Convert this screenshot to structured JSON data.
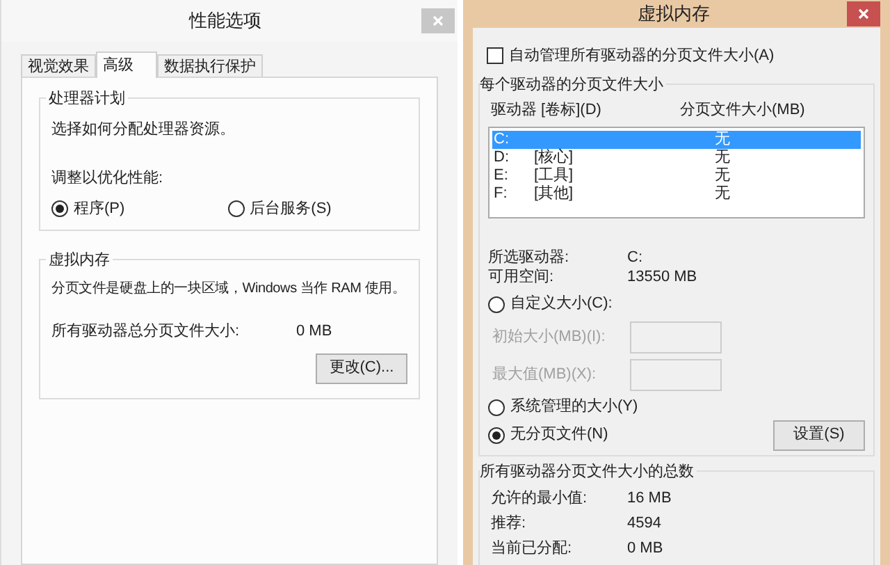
{
  "performance_window": {
    "title": "性能选项",
    "tabs": [
      {
        "label": "视觉效果",
        "selected": false
      },
      {
        "label": "高级",
        "selected": true
      },
      {
        "label": "数据执行保护",
        "selected": false
      }
    ],
    "processor_group": {
      "title": "处理器计划",
      "description": "选择如何分配处理器资源。",
      "adjust_label": "调整以优化性能:",
      "options": [
        {
          "label": "程序(P)",
          "selected": true
        },
        {
          "label": "后台服务(S)",
          "selected": false
        }
      ]
    },
    "virtual_memory_group": {
      "title": "虚拟内存",
      "description": "分页文件是硬盘上的一块区域，Windows 当作 RAM 使用。",
      "total_label": "所有驱动器总分页文件大小:",
      "total_value": "0 MB",
      "change_button": "更改(C)..."
    }
  },
  "virtual_memory_window": {
    "title": "虚拟内存",
    "auto_manage": {
      "label": "自动管理所有驱动器的分页文件大小(A)",
      "checked": false
    },
    "drives_group": {
      "title": "每个驱动器的分页文件大小",
      "columns": [
        "驱动器 [卷标](D)",
        "分页文件大小(MB)"
      ],
      "drives": [
        {
          "drive": "C:",
          "size": "无",
          "selected": true
        },
        {
          "drive": "D:",
          "label": "[核心]",
          "size": "无",
          "selected": false
        },
        {
          "drive": "E:",
          "label": "[工具]",
          "size": "无",
          "selected": false
        },
        {
          "drive": "F:",
          "label": "[其他]",
          "size": "无",
          "selected": false
        }
      ],
      "info": [
        {
          "label": "所选驱动器:",
          "value": "C:"
        },
        {
          "label": "可用空间:",
          "value": "13550 MB"
        }
      ],
      "size_options": [
        {
          "kind": "radio",
          "label": "自定义大小(C):",
          "selected": false
        },
        {
          "kind": "field",
          "label": "初始大小(MB)(I):",
          "disabled": true
        },
        {
          "kind": "field",
          "label": "最大值(MB)(X):",
          "disabled": true
        },
        {
          "kind": "radio",
          "label": "系统管理的大小(Y)",
          "selected": false
        },
        {
          "kind": "radio",
          "label": "无分页文件(N)",
          "selected": true
        }
      ],
      "set_button": "设置(S)"
    },
    "totals_group": {
      "title": "所有驱动器分页文件大小的总数",
      "rows": [
        {
          "label": "允许的最小值:",
          "value": "16 MB"
        },
        {
          "label": "推荐:",
          "value": "4594"
        },
        {
          "label": "当前已分配:",
          "value": "0 MB"
        }
      ]
    }
  }
}
